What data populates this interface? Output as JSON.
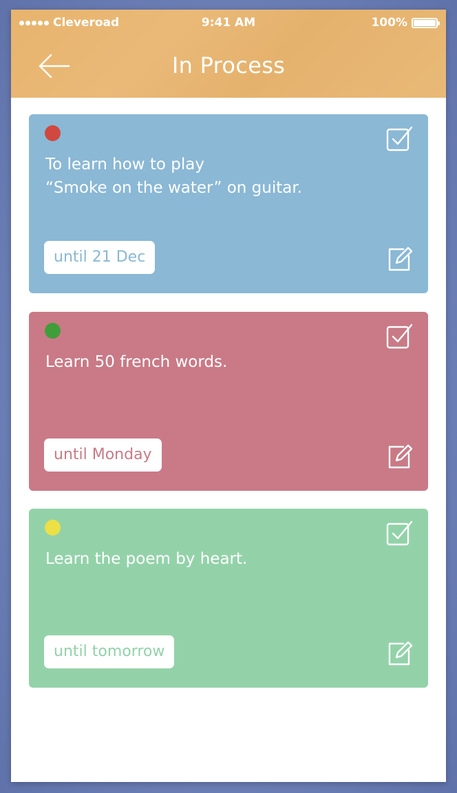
{
  "status_bar": {
    "carrier": "Cleveroad",
    "time": "9:41 AM",
    "battery": "100%"
  },
  "nav": {
    "back_icon": "arrow-left-icon",
    "title": "In Process"
  },
  "tasks": [
    {
      "priority_color": "#d0483f",
      "text_line1": "To learn how to play",
      "text_line2": "“Smoke on the water” on guitar.",
      "deadline": "until 21 Dec",
      "card_color": "#8ab8d5",
      "deadline_color": "#8ab8d5"
    },
    {
      "priority_color": "#3f9e3a",
      "text_line1": "Learn 50 french words.",
      "text_line2": "",
      "deadline": "until Monday",
      "card_color": "#c97a86",
      "deadline_color": "#c97a86"
    },
    {
      "priority_color": "#ece046",
      "text_line1": "Learn the poem by heart.",
      "text_line2": "",
      "deadline": "until tomorrow",
      "card_color": "#93d2a9",
      "deadline_color": "#93d2a9"
    }
  ],
  "icons": {
    "complete": "checkbox-checked-icon",
    "edit": "edit-icon"
  }
}
